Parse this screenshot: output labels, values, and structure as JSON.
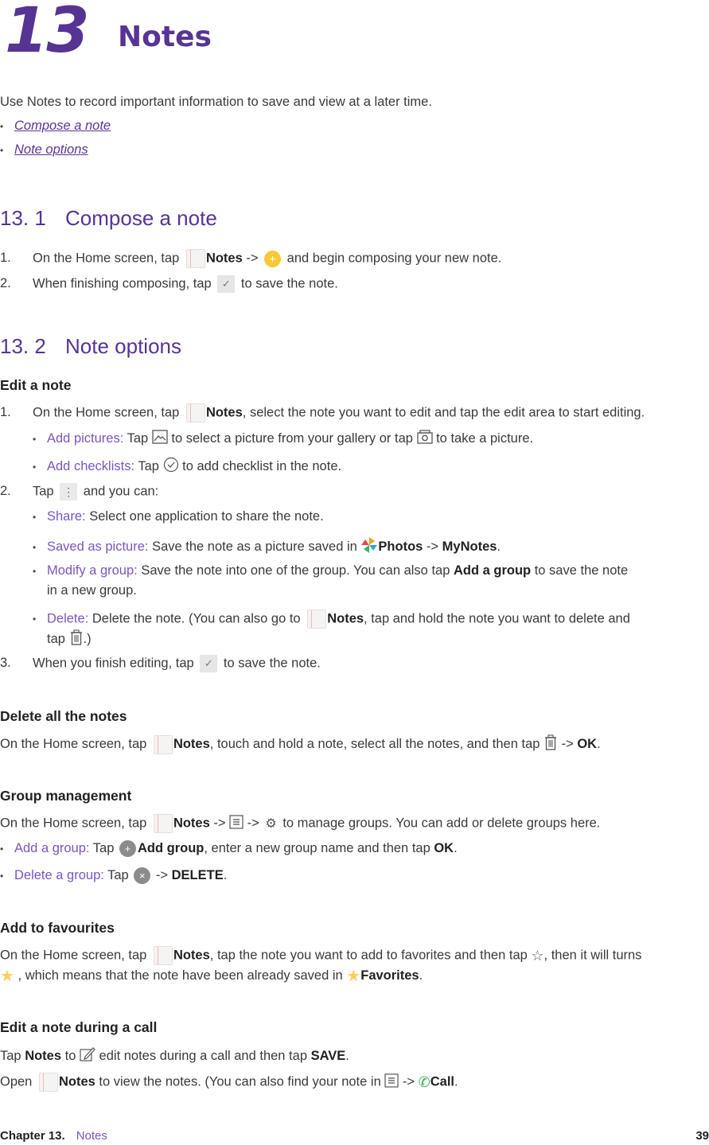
{
  "chapter": {
    "number": "13",
    "title": "Notes"
  },
  "intro": "Use Notes to record important information to save and view at a later time.",
  "toc": [
    "Compose a note",
    "Note options"
  ],
  "section1": {
    "number": "13. 1",
    "title": "Compose a note",
    "steps": [
      {
        "n": "1.",
        "a": "On the Home screen, tap ",
        "app": "Notes",
        "b": " -> ",
        "c": " and begin composing your new note."
      },
      {
        "n": "2.",
        "a": "When finishing composing, tap ",
        "c": " to save the note."
      }
    ]
  },
  "section2": {
    "number": "13. 2",
    "title": "Note options",
    "edit": {
      "heading": "Edit a note",
      "step1": {
        "n": "1.",
        "a": "On the Home screen, tap ",
        "app": "Notes",
        "c": ", select the note you want to edit and tap the edit area to start editing."
      },
      "add_pictures": {
        "label": "Add pictures:",
        "a": " Tap ",
        "b": " to select a picture from your gallery or tap ",
        "c": " to take a picture."
      },
      "add_checklists": {
        "label": "Add checklists:",
        "a": " Tap ",
        "c": " to add checklist in the note."
      },
      "step2": {
        "n": "2.",
        "a": "Tap ",
        "c": " and you can:"
      },
      "share": {
        "label": "Share:",
        "text": " Select one application to share the note."
      },
      "saved": {
        "label": "Saved as picture:",
        "a": " Save the note as a picture saved in ",
        "app": "Photos",
        "b": " -> ",
        "folder": "MyNotes",
        "c": "."
      },
      "modify": {
        "label": "Modify a group:",
        "a": " Save the note into one of the group. You can also tap ",
        "bold": "Add a group",
        "b": " to save the note",
        "line2": "in a new group."
      },
      "delete": {
        "label": "Delete:",
        "a": " Delete the note. (You can also go to ",
        "app": "Notes",
        "b": ", tap and hold the note you want to delete and",
        "line2a": "tap ",
        "line2b": ".)"
      },
      "step3": {
        "n": "3.",
        "a": "When you finish editing, tap ",
        "c": " to save the note."
      }
    },
    "delete_all": {
      "heading": "Delete all the notes",
      "a": "On the Home screen, tap ",
      "app": "Notes",
      "b": ", touch and hold a note, select all the notes, and then tap ",
      "c": " -> ",
      "ok": "OK",
      "d": "."
    },
    "group": {
      "heading": "Group management",
      "a": "On the Home screen, tap ",
      "app": "Notes",
      "b": " -> ",
      "c": " -> ",
      "d": " to manage groups. You can add or delete groups here.",
      "add": {
        "label": "Add a group:",
        "a": " Tap ",
        "bold": "Add group",
        "b": ", enter a new group name and then tap ",
        "ok": "OK",
        "c": "."
      },
      "del": {
        "label": "Delete a group:",
        "a": " Tap ",
        "b": " -> ",
        "bold": "DELETE",
        "c": "."
      }
    },
    "favourites": {
      "heading": "Add to favourites",
      "a": "On the Home screen, tap ",
      "app": "Notes",
      "b": ", tap the note you want to add to favorites and then tap ",
      "c": ", then it will turns",
      "line2a": " , which means that the note have been already saved in ",
      "fav": "Favorites",
      "line2b": "."
    },
    "call": {
      "heading": "Edit a note during a call",
      "l1a": "Tap ",
      "l1app": "Notes",
      "l1b": " to ",
      "l1c": " edit notes during a call and then tap ",
      "save": "SAVE",
      "l1d": ".",
      "l2a": "Open ",
      "l2app": "Notes",
      "l2b": " to view the notes. (You can also find your note in ",
      "l2c": " -> ",
      "call": "Call",
      "l2d": "."
    }
  },
  "footer": {
    "chapter": "Chapter 13.",
    "subtitle": "Notes",
    "page": "39"
  },
  "colors": {
    "accent": "#563494",
    "label": "#7b55c0",
    "plus_icon": "#f7c936",
    "star": "#f9cf5a",
    "phone": "#2fb24c"
  }
}
